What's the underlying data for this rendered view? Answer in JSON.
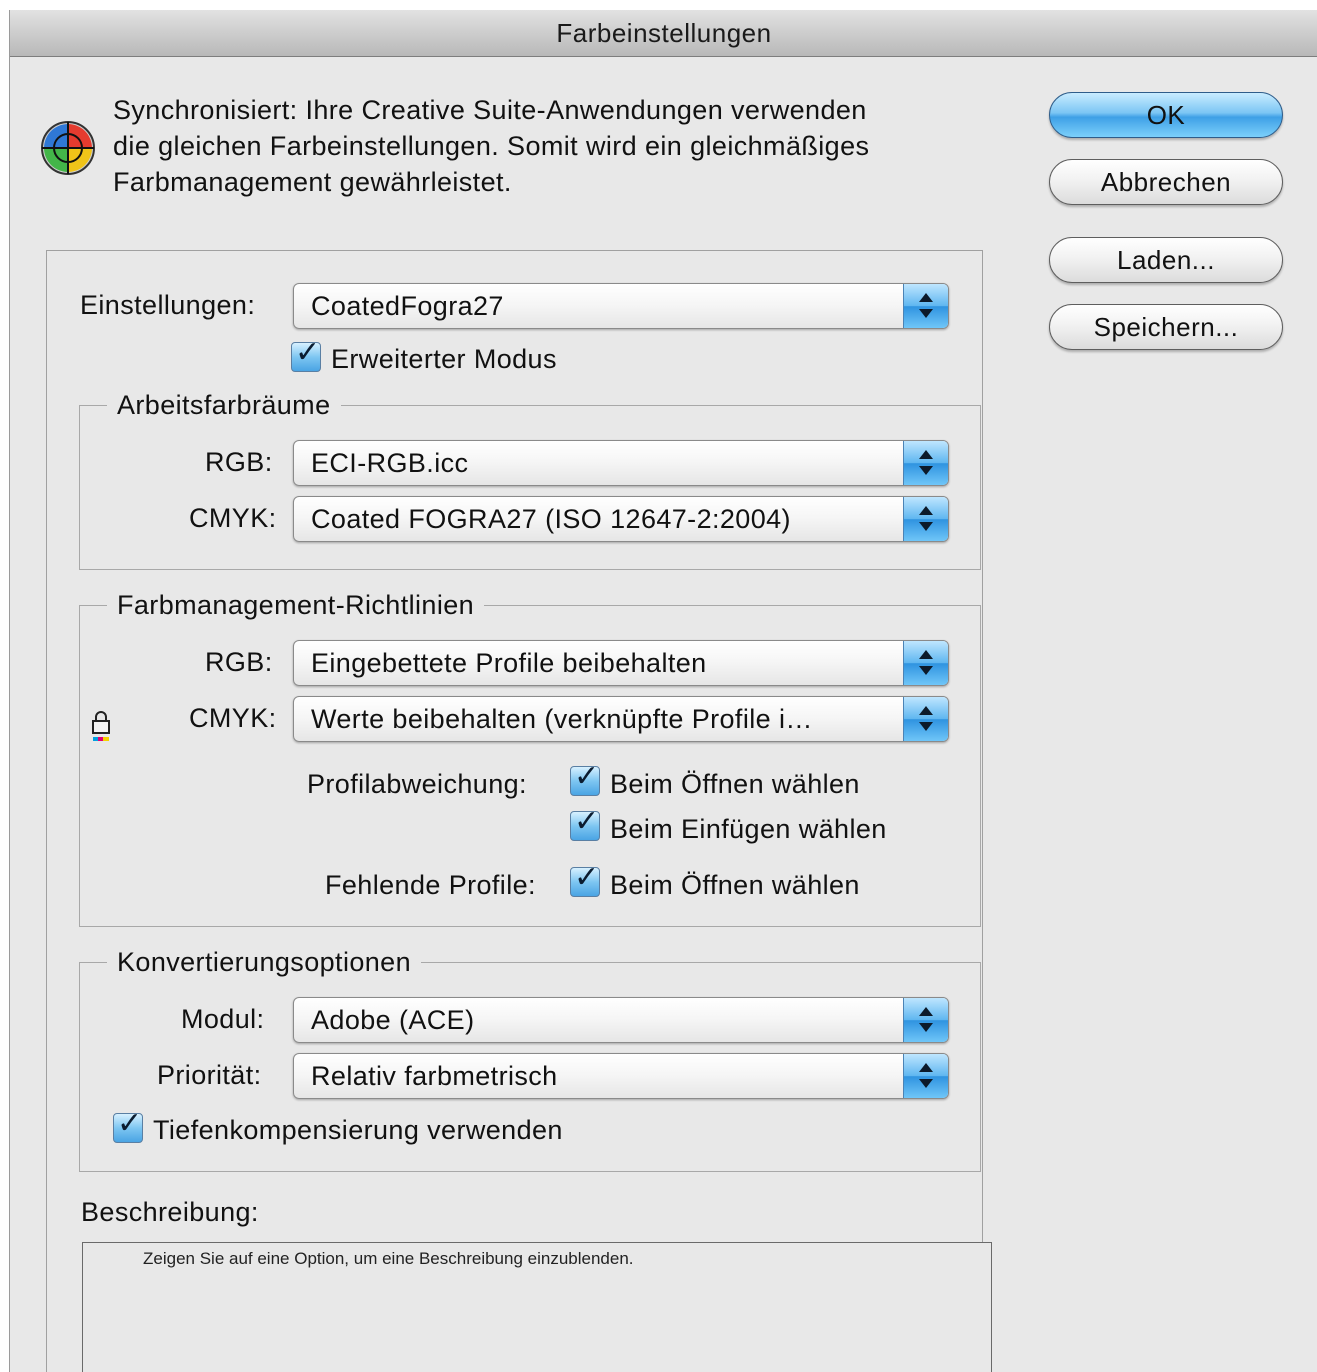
{
  "window": {
    "title": "Farbeinstellungen"
  },
  "sync": {
    "line1": "Synchronisiert: Ihre Creative Suite-Anwendungen verwenden",
    "line2": "die gleichen Farbeinstellungen. Somit wird ein gleichmäßiges",
    "line3": "Farbmanagement gewährleistet."
  },
  "buttons": {
    "ok": "OK",
    "cancel": "Abbrechen",
    "load": "Laden...",
    "save": "Speichern..."
  },
  "settings": {
    "label": "Einstellungen:",
    "value": "CoatedFogra27",
    "advanced_mode": {
      "label": "Erweiterter Modus",
      "checked": true
    }
  },
  "working_spaces": {
    "title": "Arbeitsfarbräume",
    "rgb_label": "RGB:",
    "rgb_value": "ECI-RGB.icc",
    "cmyk_label": "CMYK:",
    "cmyk_value": "Coated FOGRA27 (ISO 12647-2:2004)"
  },
  "policies": {
    "title": "Farbmanagement-Richtlinien",
    "rgb_label": "RGB:",
    "rgb_value": "Eingebettete Profile beibehalten",
    "cmyk_label": "CMYK:",
    "cmyk_value": "Werte beibehalten (verknüpfte Profile i…",
    "mismatch_label": "Profilabweichung:",
    "ask_open": "Beim Öffnen wählen",
    "ask_paste": "Beim Einfügen wählen",
    "missing_label": "Fehlende Profile:",
    "missing_open": "Beim Öffnen wählen"
  },
  "conversion": {
    "title": "Konvertierungsoptionen",
    "engine_label": "Modul:",
    "engine_value": "Adobe (ACE)",
    "intent_label": "Priorität:",
    "intent_value": "Relativ farbmetrisch",
    "bpc_label": "Tiefenkompensierung verwenden"
  },
  "description": {
    "label": "Beschreibung:",
    "text": "Zeigen Sie auf eine Option, um eine Beschreibung einzublenden."
  }
}
